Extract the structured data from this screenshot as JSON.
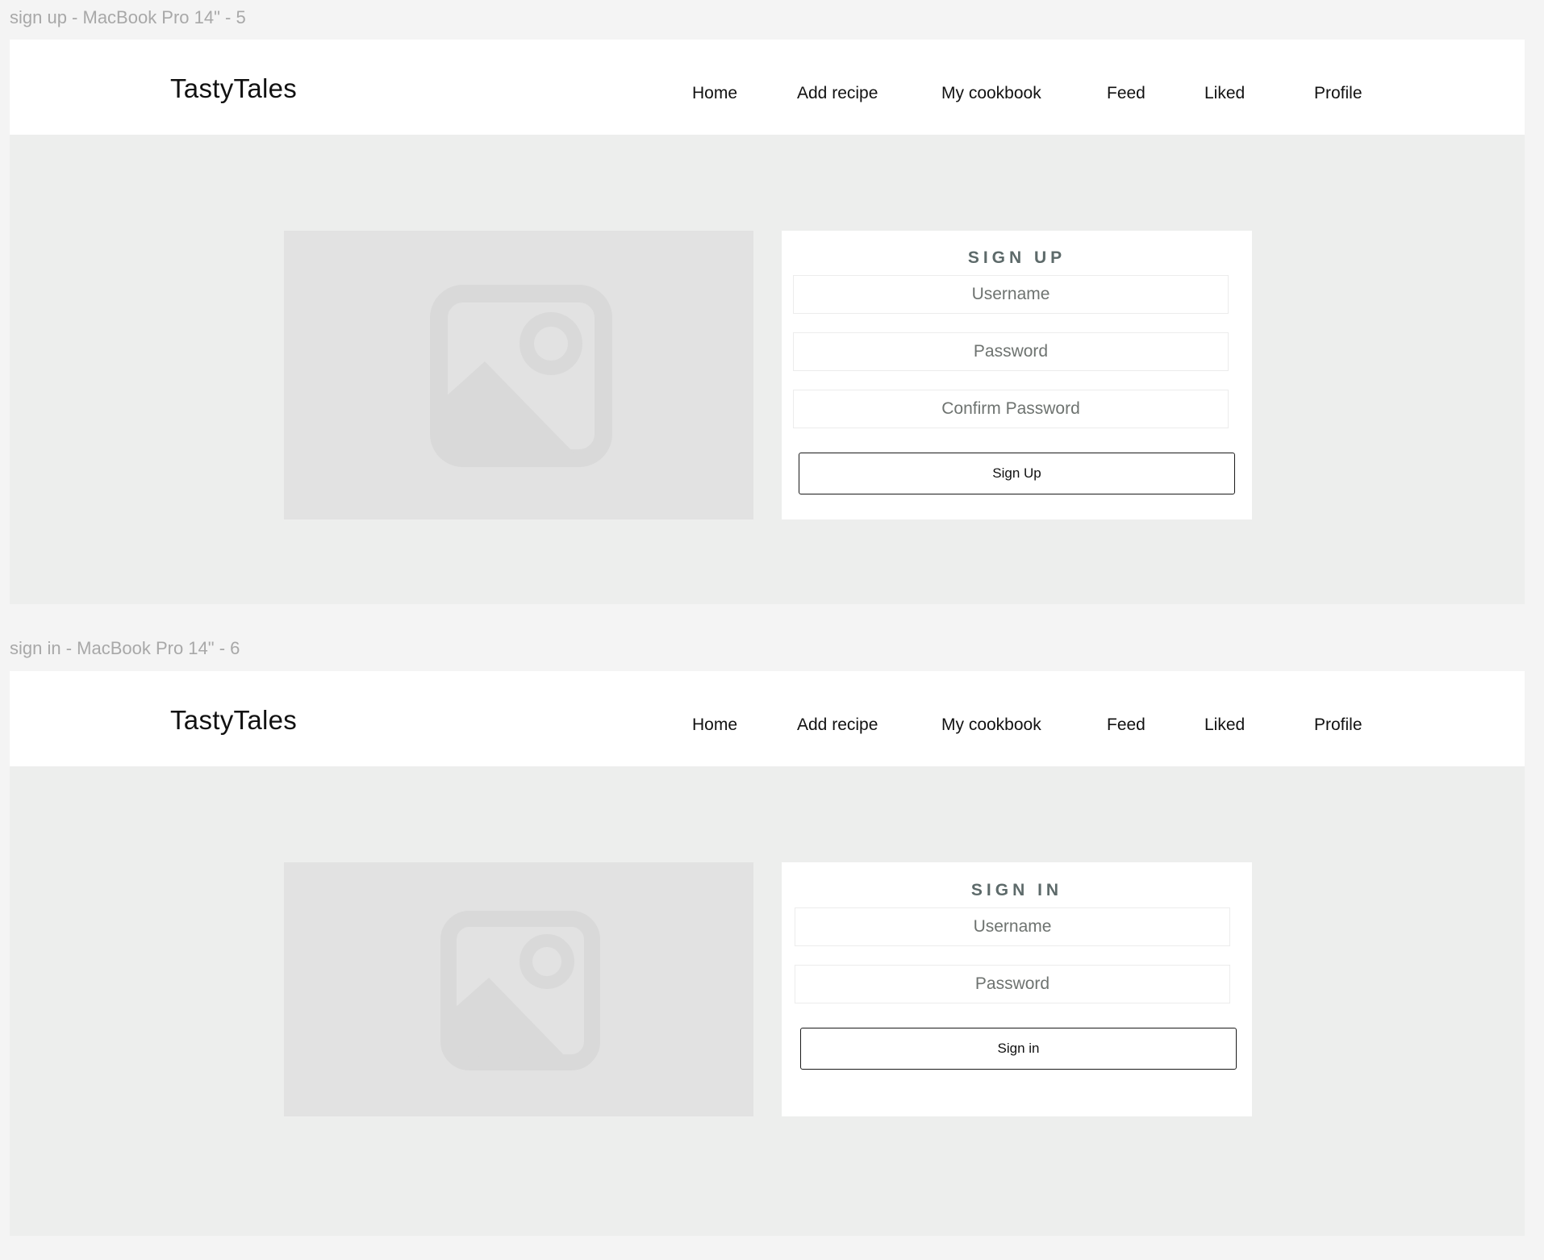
{
  "frames": [
    {
      "label": "sign up - MacBook Pro 14\" - 5",
      "logo": "TastyTales",
      "nav": [
        "Home",
        "Add recipe",
        "My cookbook",
        "Feed",
        "Liked",
        "Profile"
      ],
      "form": {
        "title": "SIGN UP",
        "fields": [
          "Username",
          "Password",
          "Confirm Password"
        ],
        "button": "Sign Up"
      },
      "image_icon": "image-placeholder-icon"
    },
    {
      "label": "sign in - MacBook Pro 14\" - 6",
      "logo": "TastyTales",
      "nav": [
        "Home",
        "Add recipe",
        "My cookbook",
        "Feed",
        "Liked",
        "Profile"
      ],
      "form": {
        "title": "SIGN IN",
        "fields": [
          "Username",
          "Password"
        ],
        "button": "Sign in"
      },
      "image_icon": "image-placeholder-icon"
    }
  ]
}
